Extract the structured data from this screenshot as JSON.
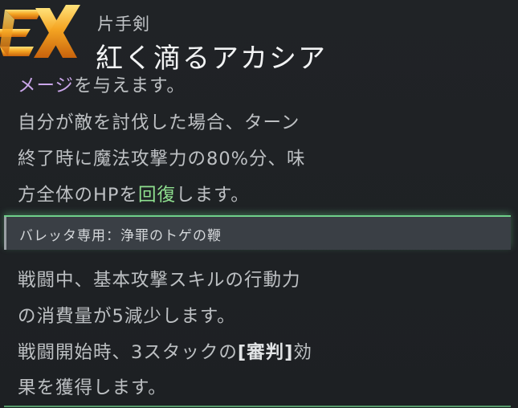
{
  "badge": {
    "text": "EX",
    "icon": "ex-rank-emblem"
  },
  "weapon": {
    "type": "片手剣",
    "name": "紅く滴るアカシア"
  },
  "description": {
    "line1_highlight": "メージ",
    "line1_rest": "を与えます。",
    "line2": "自分が敵を討伐した場合、ターン",
    "line3": "終了時に魔法攻撃力の80%分、味",
    "line4_pre": "方全体のHPを",
    "line4_highlight": "回復",
    "line4_post": "します。"
  },
  "exclusive": {
    "label": "バレッタ専用：浄罪のトゲの鞭"
  },
  "effect": {
    "line1": "戦闘中、基本攻撃スキルの行動力",
    "line2": "の消費量が5減少します。",
    "line3_pre": "戦闘開始時、3スタックの",
    "line3_bold": "[審判]",
    "line3_post": "効",
    "line4": "果を獲得します。"
  },
  "colors": {
    "highlight_purple": "#caa6ea",
    "highlight_green": "#8fe08f",
    "accent_green": "#6fd08a",
    "badge_gold": "#f0a020"
  }
}
